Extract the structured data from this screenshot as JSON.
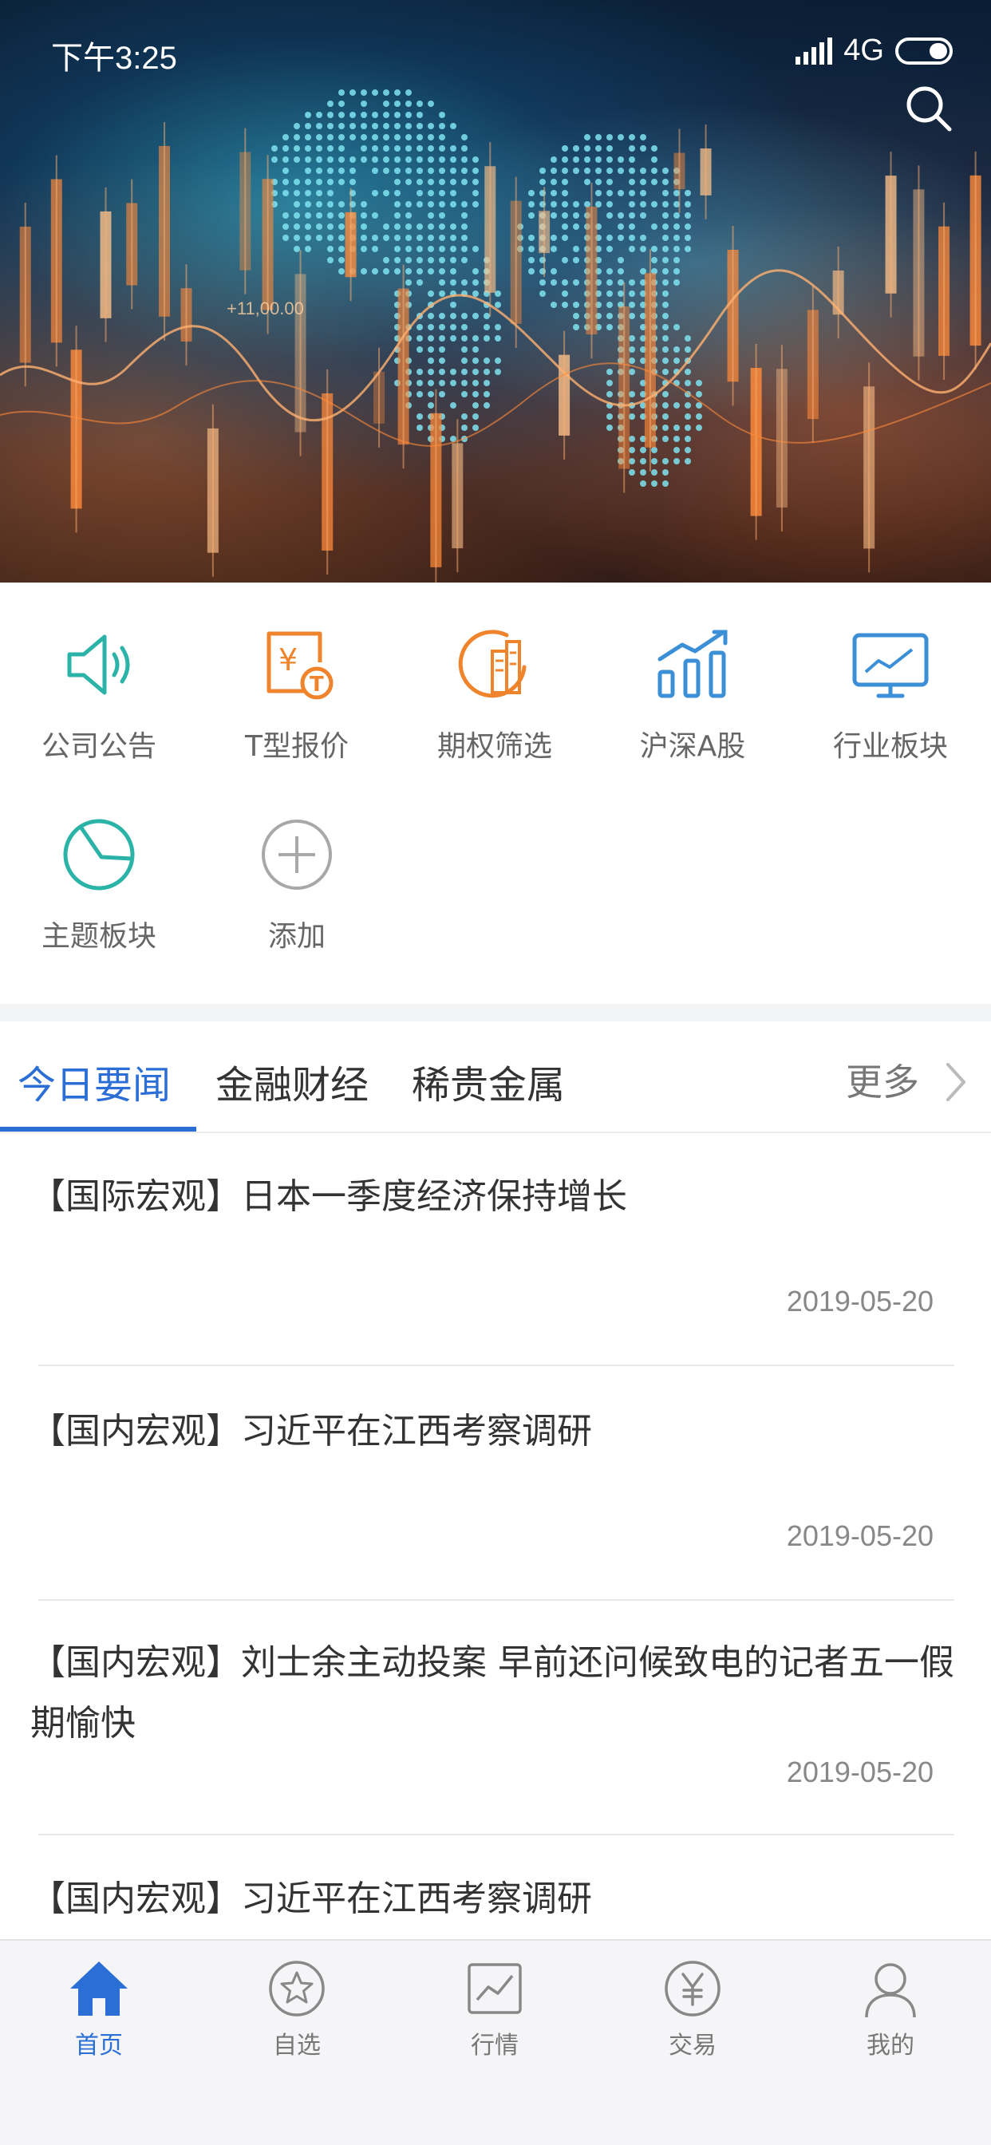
{
  "status_bar": {
    "time": "下午3:25",
    "network": "4G"
  },
  "quick_menu": {
    "items": [
      {
        "label": "公司公告",
        "icon": "speaker-icon"
      },
      {
        "label": "T型报价",
        "icon": "price-t-icon"
      },
      {
        "label": "期权筛选",
        "icon": "option-filter-icon"
      },
      {
        "label": "沪深A股",
        "icon": "bar-chart-trend-icon"
      },
      {
        "label": "行业板块",
        "icon": "monitor-chart-icon"
      },
      {
        "label": "主题板块",
        "icon": "pie-chart-icon"
      },
      {
        "label": "添加",
        "icon": "add-circle-icon"
      }
    ]
  },
  "news_tabs": {
    "tabs": [
      {
        "label": "今日要闻",
        "active": true
      },
      {
        "label": "金融财经",
        "active": false
      },
      {
        "label": "稀贵金属",
        "active": false
      }
    ],
    "more_label": "更多"
  },
  "news": {
    "items": [
      {
        "title": "【国际宏观】日本一季度经济保持增长",
        "date": "2019-05-20"
      },
      {
        "title": "【国内宏观】习近平在江西考察调研",
        "date": "2019-05-20"
      },
      {
        "title": "【国内宏观】刘士余主动投案 早前还问候致电的记者五一假期愉快",
        "date": "2019-05-20"
      },
      {
        "title": "【国内宏观】习近平在江西考察调研",
        "date": ""
      }
    ]
  },
  "bottom_nav": {
    "items": [
      {
        "label": "首页",
        "icon": "home-icon",
        "active": true
      },
      {
        "label": "自选",
        "icon": "star-circle-icon",
        "active": false
      },
      {
        "label": "行情",
        "icon": "market-chart-icon",
        "active": false
      },
      {
        "label": "交易",
        "icon": "yen-circle-icon",
        "active": false
      },
      {
        "label": "我的",
        "icon": "user-icon",
        "active": false
      }
    ]
  },
  "colors": {
    "accent": "#2b6fd6",
    "teal_icon": "#2bb3a8",
    "orange_icon": "#f0842c",
    "blue_icon": "#3a8fd6"
  }
}
